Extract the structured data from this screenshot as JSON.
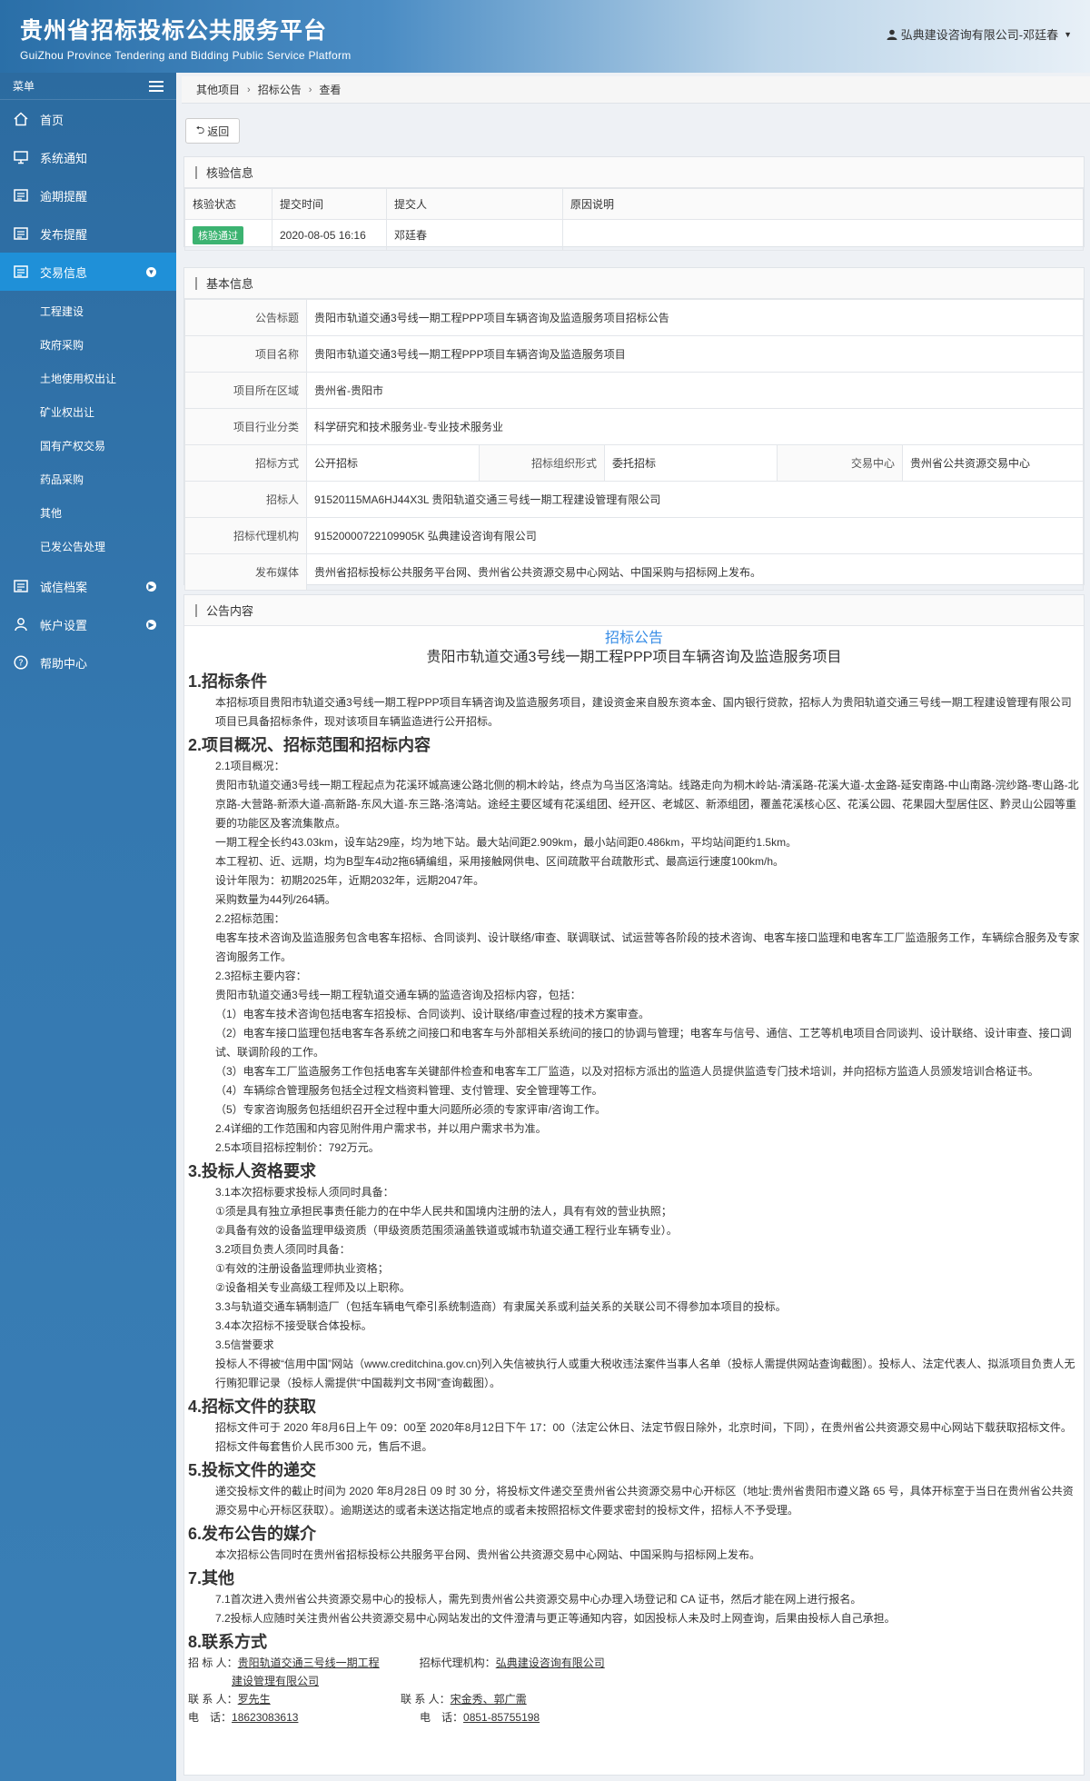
{
  "header": {
    "title": "贵州省招标投标公共服务平台",
    "subtitle": "GuiZhou Province Tendering and Bidding Public Service Platform",
    "user": "弘典建设咨询有限公司-邓廷春"
  },
  "sidebar": {
    "menu_label": "菜单",
    "items": [
      {
        "label": "首页",
        "icon": "home-icon"
      },
      {
        "label": "系统通知",
        "icon": "monitor-icon"
      },
      {
        "label": "逾期提醒",
        "icon": "list-icon"
      },
      {
        "label": "发布提醒",
        "icon": "list-icon"
      },
      {
        "label": "交易信息",
        "icon": "list-icon"
      }
    ],
    "sub_items": [
      "工程建设",
      "政府采购",
      "土地使用权出让",
      "矿业权出让",
      "国有产权交易",
      "药品采购",
      "其他",
      "已发公告处理"
    ],
    "bottom_items": [
      {
        "label": "诚信档案",
        "icon": "list-icon"
      },
      {
        "label": "帐户设置",
        "icon": "user-icon"
      },
      {
        "label": "帮助中心",
        "icon": "help-icon"
      }
    ]
  },
  "breadcrumb": [
    "其他项目",
    "招标公告",
    "查看"
  ],
  "back_label": "返回",
  "verify": {
    "title": "核验信息",
    "headers": [
      "核验状态",
      "提交时间",
      "提交人",
      "原因说明"
    ],
    "status": "核验通过",
    "time": "2020-08-05 16:16",
    "submitter": "邓廷春",
    "reason": ""
  },
  "basic": {
    "title": "基本信息",
    "rows": [
      {
        "label": "公告标题",
        "value": "贵阳市轨道交通3号线一期工程PPP项目车辆咨询及监造服务项目招标公告"
      },
      {
        "label": "项目名称",
        "value": "贵阳市轨道交通3号线一期工程PPP项目车辆咨询及监造服务项目"
      },
      {
        "label": "项目所在区域",
        "value": "贵州省-贵阳市"
      },
      {
        "label": "项目行业分类",
        "value": "科学研究和技术服务业-专业技术服务业"
      }
    ],
    "method_label": "招标方式",
    "method_value": "公开招标",
    "org_label": "招标组织形式",
    "org_value": "委托招标",
    "center_label": "交易中心",
    "center_value": "贵州省公共资源交易中心",
    "rows2": [
      {
        "label": "招标人",
        "value": "91520115MA6HJ44X3L 贵阳轨道交通三号线一期工程建设管理有限公司"
      },
      {
        "label": "招标代理机构",
        "value": "91520000722109905K 弘典建设咨询有限公司"
      },
      {
        "label": "发布媒体",
        "value": "贵州省招标投标公共服务平台网、贵州省公共资源交易中心网站、中国采购与招标网上发布。"
      }
    ]
  },
  "announcement": {
    "panel_title": "公告内容",
    "title": "招标公告",
    "subtitle": "贵阳市轨道交通3号线一期工程PPP项目车辆咨询及监造服务项目",
    "s1": "1.招标条件",
    "s1_p": "本招标项目贵阳市轨道交通3号线一期工程PPP项目车辆咨询及监造服务项目，建设资金来自股东资本金、国内银行贷款，招标人为贵阳轨道交通三号线一期工程建设管理有限公司项目已具备招标条件，现对该项目车辆监造进行公开招标。",
    "s2": "2.项目概况、招标范围和招标内容",
    "s2_lines": [
      "2.1项目概况：",
      "贵阳市轨道交通3号线一期工程起点为花溪环城高速公路北侧的桐木岭站，终点为乌当区洛湾站。线路走向为桐木岭站-清溪路-花溪大道-太金路-延安南路-中山南路-浣纱路-枣山路-北京路-大营路-新添大道-高新路-东风大道-东三路-洛湾站。途经主要区域有花溪组团、经开区、老城区、新添组团，覆盖花溪核心区、花溪公园、花果园大型居住区、黔灵山公园等重要的功能区及客流集散点。",
      "一期工程全长约43.03km，设车站29座，均为地下站。最大站间距2.909km，最小站间距0.486km，平均站间距约1.5km。",
      "本工程初、近、远期，均为B型车4动2拖6辆编组，采用接触网供电、区间疏散平台疏散形式、最高运行速度100km/h。",
      "设计年限为：初期2025年，近期2032年，远期2047年。",
      "采购数量为44列/264辆。",
      "2.2招标范围：",
      "电客车技术咨询及监造服务包含电客车招标、合同谈判、设计联络/审查、联调联试、试运营等各阶段的技术咨询、电客车接口监理和电客车工厂监造服务工作，车辆综合服务及专家咨询服务工作。",
      "2.3招标主要内容：",
      "贵阳市轨道交通3号线一期工程轨道交通车辆的监造咨询及招标内容，包括：",
      "（1）电客车技术咨询包括电客车招投标、合同谈判、设计联络/审查过程的技术方案审查。",
      "（2）电客车接口监理包括电客车各系统之间接口和电客车与外部相关系统间的接口的协调与管理；电客车与信号、通信、工艺等机电项目合同谈判、设计联络、设计审查、接口调试、联调阶段的工作。",
      "（3）电客车工厂监造服务工作包括电客车关键部件检查和电客车工厂监造，以及对招标方派出的监造人员提供监造专门技术培训，并向招标方监造人员颁发培训合格证书。",
      "（4）车辆综合管理服务包括全过程文档资料管理、支付管理、安全管理等工作。",
      "（5）专家咨询服务包括组织召开全过程中重大问题所必须的专家评审/咨询工作。",
      "2.4详细的工作范围和内容见附件用户需求书，并以用户需求书为准。",
      "2.5本项目招标控制价：792万元。"
    ],
    "s3": "3.投标人资格要求",
    "s3_lines": [
      "3.1本次招标要求投标人须同时具备：",
      "①须是具有独立承担民事责任能力的在中华人民共和国境内注册的法人，具有有效的营业执照；",
      "②具备有效的设备监理甲级资质（甲级资质范围须涵盖铁道或城市轨道交通工程行业车辆专业）。",
      "3.2项目负责人须同时具备：",
      "①有效的注册设备监理师执业资格；",
      "②设备相关专业高级工程师及以上职称。",
      "3.3与轨道交通车辆制造厂（包括车辆电气牵引系统制造商）有隶属关系或利益关系的关联公司不得参加本项目的投标。",
      "3.4本次招标不接受联合体投标。",
      "3.5信誉要求",
      "投标人不得被“信用中国”网站（www.creditchina.gov.cn)列入失信被执行人或重大税收违法案件当事人名单（投标人需提供网站查询截图）。投标人、法定代表人、拟派项目负责人无行贿犯罪记录（投标人需提供“中国裁判文书网”查询截图）。"
    ],
    "s4": "4.招标文件的获取",
    "s4_p": "招标文件可于 2020 年8月6日上午 09：00至 2020年8月12日下午 17：00（法定公休日、法定节假日除外，北京时间，下同），在贵州省公共资源交易中心网站下载获取招标文件。招标文件每套售价人民币300 元，售后不退。",
    "s5": "5.投标文件的递交",
    "s5_p": "递交投标文件的截止时间为 2020 年8月28日 09 时 30 分，将投标文件递交至贵州省公共资源交易中心开标区（地址:贵州省贵阳市遵义路 65 号，具体开标室于当日在贵州省公共资源交易中心开标区获取）。逾期送达的或者未送达指定地点的或者未按照招标文件要求密封的投标文件，招标人不予受理。",
    "s6": "6.发布公告的媒介",
    "s6_p": "本次招标公告同时在贵州省招标投标公共服务平台网、贵州省公共资源交易中心网站、中国采购与招标网上发布。",
    "s7": "7.其他",
    "s7_lines": [
      "7.1首次进入贵州省公共资源交易中心的投标人，需先到贵州省公共资源交易中心办理入场登记和 CA 证书，然后才能在网上进行报名。",
      "7.2投标人应随时关注贵州省公共资源交易中心网站发出的文件澄清与更正等通知内容，如因投标人未及时上网查询，后果由投标人自己承担。"
    ],
    "s8": "8.联系方式",
    "contact": {
      "tenderer_label": "招 标 人：",
      "tenderer": "贵阳轨道交通三号线一期工程",
      "tenderer2": "建设管理有限公司",
      "agent_label": "招标代理机构：",
      "agent": "弘典建设咨询有限公司",
      "person_label": "联 系 人：",
      "person1": "罗先生",
      "person2": "宋金秀、郭广需",
      "phone_label": "电　话：",
      "phone1": "18623083613",
      "phone2": "0851-85755198"
    }
  }
}
